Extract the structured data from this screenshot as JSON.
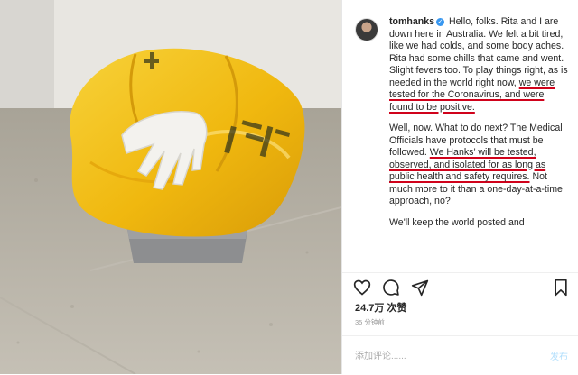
{
  "post": {
    "username": "tomhanks",
    "verified": true,
    "caption_p1_a": "Hello, folks. Rita and I are down here in Australia. We felt a bit tired, like we had colds, and some body aches. Rita had some chills that came and went. Slight fevers too. To play things right, as is needed in the world right now,",
    "caption_p1_b": "we were tested for the Coronavirus, and were found to be positive.",
    "caption_p2_a": "Well, now. What to do next? The Medical Officials have protocols that must be followed.",
    "caption_p2_b": "We Hanks’ will be tested, observed, and isolated for as long as public health and safety requires.",
    "caption_p2_c": "Not much more to it than a one-day-at-a-time approach, no?",
    "caption_p3": "We'll keep the world posted and"
  },
  "stats": {
    "likes": "24.7万 次赞",
    "time": "35 分钟前"
  },
  "comment": {
    "placeholder": "添加评论......",
    "post_label": "发布"
  },
  "icons": {
    "like": "heart-icon",
    "comment": "comment-icon",
    "share": "share-icon",
    "save": "bookmark-icon"
  },
  "colors": {
    "underline": "#d0021b",
    "verified": "#3897f0",
    "bag": "#f2c01c"
  }
}
